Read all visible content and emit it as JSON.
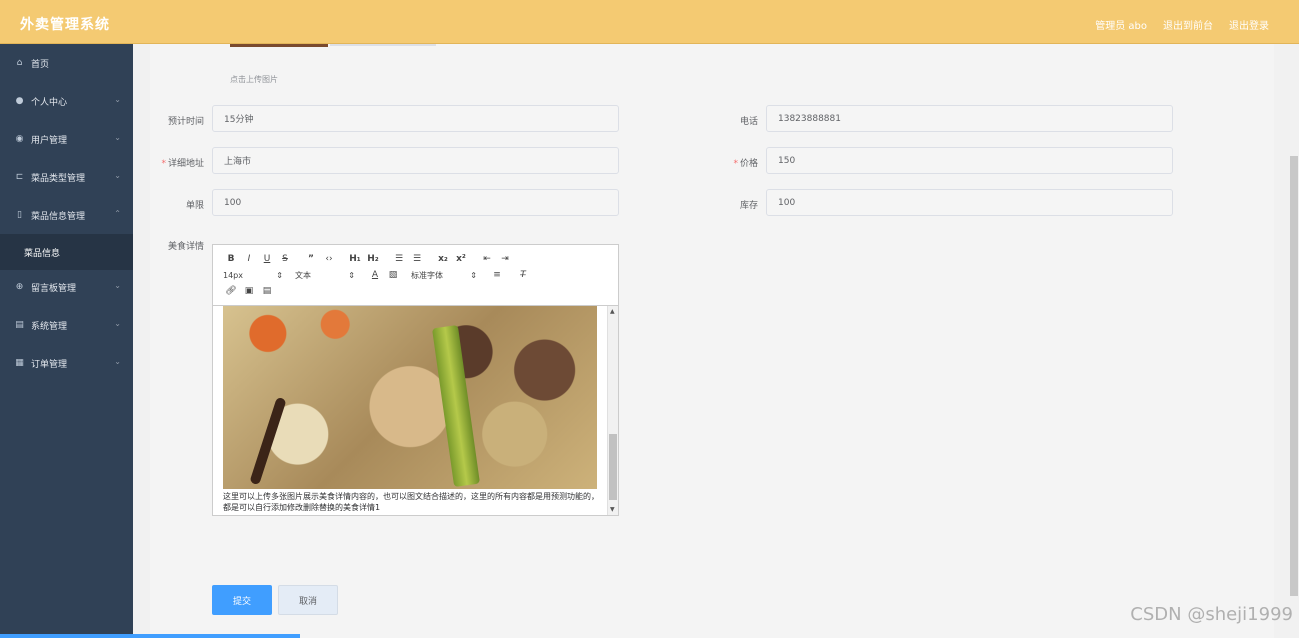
{
  "header": {
    "title": "外卖管理系统",
    "links": [
      "管理员 abo",
      "退出到前台",
      "退出登录"
    ]
  },
  "sidebar": {
    "items": [
      {
        "label": "首页",
        "icon": "home-icon",
        "expandable": false
      },
      {
        "label": "个人中心",
        "icon": "user-icon",
        "expandable": true
      },
      {
        "label": "用户管理",
        "icon": "location-icon",
        "expandable": true
      },
      {
        "label": "菜品类型管理",
        "icon": "crop-icon",
        "expandable": true
      },
      {
        "label": "菜品信息管理",
        "icon": "phone-icon",
        "expandable": true,
        "open": true
      },
      {
        "label": "留言板管理",
        "icon": "globe-icon",
        "expandable": true
      },
      {
        "label": "系统管理",
        "icon": "clipboard-icon",
        "expandable": true
      },
      {
        "label": "订单管理",
        "icon": "grid-icon",
        "expandable": true
      }
    ],
    "subitem": "菜品信息"
  },
  "form": {
    "upload_hint": "点击上传图片",
    "fields": {
      "time": {
        "label": "预计时间",
        "value": "15分钟",
        "required": false
      },
      "phone": {
        "label": "电话",
        "value": "13823888881",
        "required": false
      },
      "address": {
        "label": "详细地址",
        "value": "上海市",
        "required": true
      },
      "price": {
        "label": "价格",
        "value": "150",
        "required": true
      },
      "limit": {
        "label": "单限",
        "value": "100",
        "required": false
      },
      "stock": {
        "label": "库存",
        "value": "100",
        "required": false
      }
    },
    "detail_label": "美食详情",
    "editor": {
      "font_size": "14px",
      "text_style": "文本",
      "font_family": "标准字体",
      "caption": "这里可以上传多张图片展示美食详情内容的，也可以图文结合描述的，这里的所有内容都是用预测功能的，都是可以自行添加修改删除替换的美食详情1"
    },
    "submit_label": "提交",
    "cancel_label": "取消"
  },
  "watermark": "CSDN @sheji1999",
  "colors": {
    "header": "#f4ca72",
    "sidebar": "#304156",
    "primary": "#409eff",
    "required": "#f56c6c"
  }
}
